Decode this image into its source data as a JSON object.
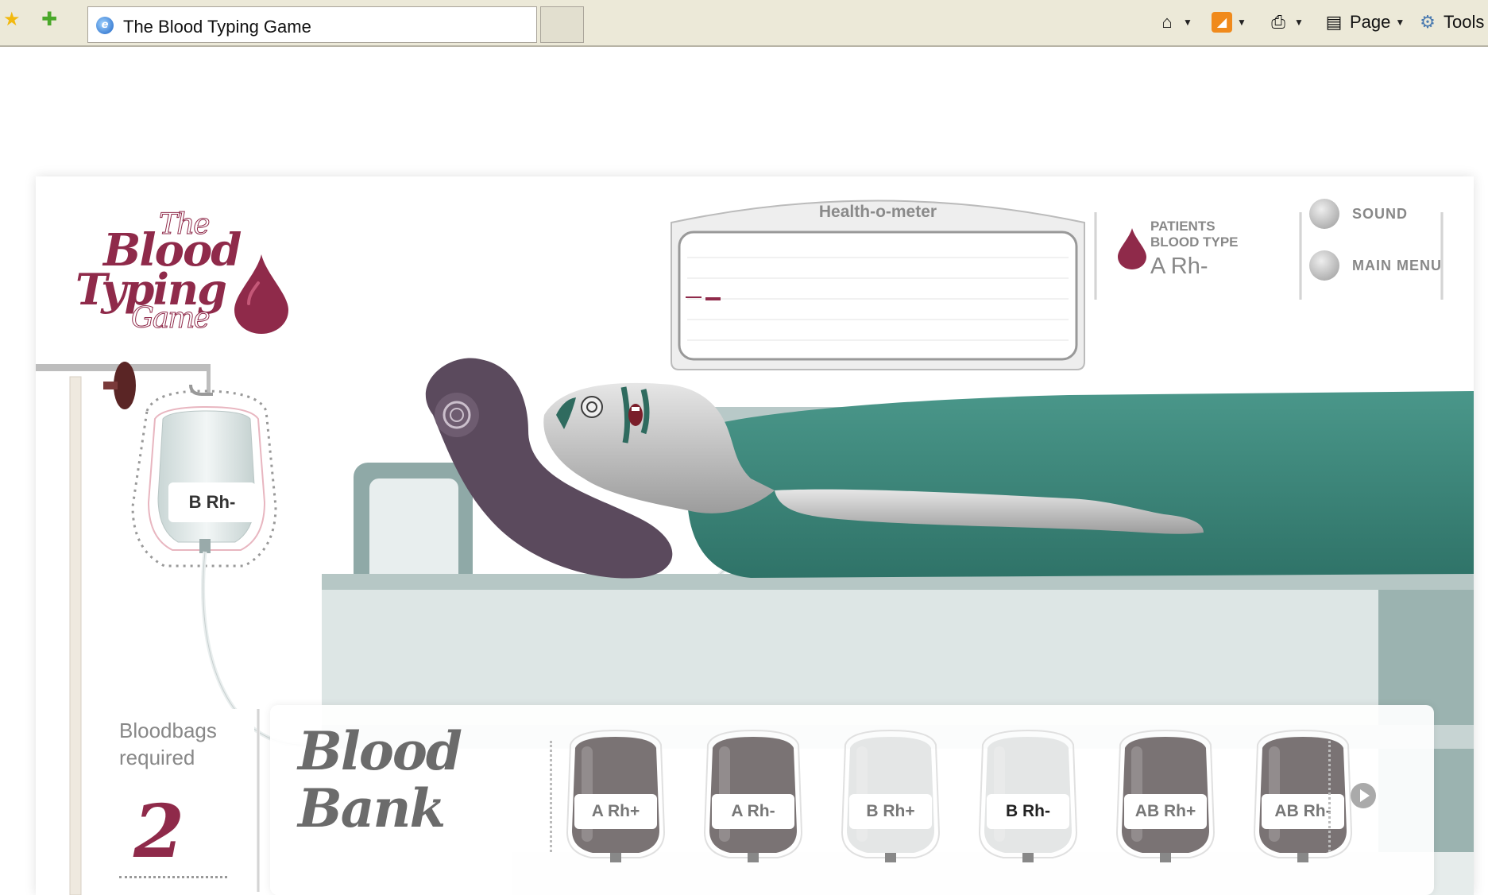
{
  "browser": {
    "tab_title": "The Blood Typing Game",
    "toolbar": {
      "page_label": "Page",
      "tools_label": "Tools"
    }
  },
  "game": {
    "logo": {
      "line1": "The",
      "line2": "Blood",
      "line3": "Typing",
      "line4": "Game"
    },
    "health_meter": {
      "title": "Health-o-meter"
    },
    "patient": {
      "label": "PATIENTS BLOOD TYPE",
      "blood_type": "A Rh-"
    },
    "options": {
      "sound_label": "SOUND",
      "menu_label": "MAIN MENU"
    },
    "iv_bag": {
      "label": "B Rh-"
    },
    "bloodbags_required": {
      "label": "Bloodbags required",
      "count": "2"
    },
    "blood_bank": {
      "title_line1": "Blood",
      "title_line2": "Bank",
      "bags": [
        {
          "label": "A Rh+",
          "color": "#7a7374"
        },
        {
          "label": "A Rh-",
          "color": "#7a7374"
        },
        {
          "label": "B Rh+",
          "color": "#e4e6e6"
        },
        {
          "label": "B Rh-",
          "color": "#e4e6e6"
        },
        {
          "label": "AB Rh+",
          "color": "#7a7374"
        },
        {
          "label": "AB Rh-",
          "color": "#7a7374"
        }
      ]
    },
    "colors": {
      "brand": "#8f2a4a",
      "sheet": "#3f8a7e",
      "hair": "#5b4a5d"
    }
  }
}
